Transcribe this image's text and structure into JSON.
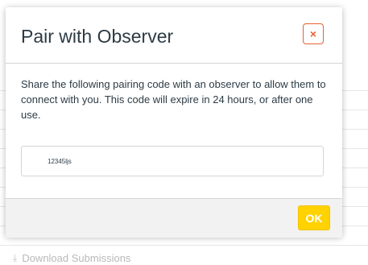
{
  "modal": {
    "title": "Pair with Observer",
    "close_label": "×",
    "description": "Share the following pairing code with an observer to allow them to connect with you. This code will expire in 24 hours, or after one use.",
    "pairing_code": "12345ljs",
    "ok_label": "OK"
  },
  "background": {
    "download_label": "Download Submissions",
    "download_icon": "download-icon"
  },
  "colors": {
    "close_accent": "#e66135",
    "ok_button": "#ffd200",
    "title_text": "#2d3b45"
  }
}
